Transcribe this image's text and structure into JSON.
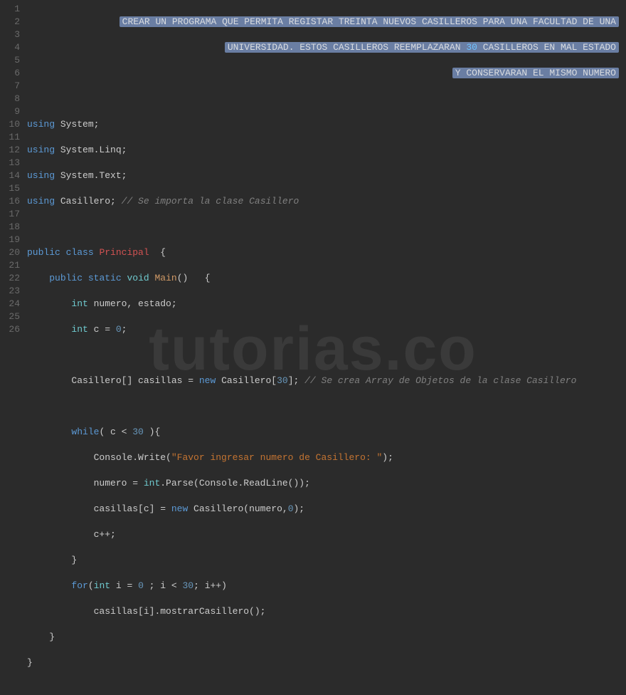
{
  "comment_banner": {
    "line1": "CREAR UN PROGRAMA QUE PERMITA REGISTAR TREINTA NUEVOS CASILLEROS PARA UNA FACULTAD DE UNA",
    "line2_pre": "UNIVERSIDAD. ESTOS CASILLEROS REEMPLAZARAN ",
    "line2_num": "30",
    "line2_post": " CASILLEROS EN MAL ESTADO",
    "line3": "Y CONSERVARAN EL MISMO NUMERO"
  },
  "code": {
    "using": "using",
    "ns_system": "System;",
    "ns_linq": "System.Linq;",
    "ns_text": "System.Text;",
    "ns_casillero": "Casillero;",
    "import_comment": "// Se importa la clase Casillero",
    "public": "public",
    "class": "class",
    "className": "Principal",
    "static": "static",
    "void": "void",
    "main": "Main",
    "parens_open_brace": "()   {",
    "int": "int",
    "decl_vars": " numero, estado;",
    "decl_c": " c = ",
    "zero": "0",
    "semi": ";",
    "casillero_type": "Casillero",
    "arr_decl": "[] casillas = ",
    "new": "new",
    "arr_alloc_pre": " Casillero[",
    "thirty": "30",
    "arr_alloc_post": "];",
    "arr_comment": "// Se crea Array de Objetos de la clase Casillero",
    "while": "while",
    "while_cond_pre": "( c < ",
    "while_cond_post": " ){",
    "console_write": "Console.Write(",
    "string_prompt": "\"Favor ingresar numero de Casillero: \"",
    "close_paren_semi": ");",
    "numero_assign": "numero = ",
    "int_parse": ".Parse(Console.ReadLine());",
    "casillas_assign_pre": "casillas[c] = ",
    "casillero_ctor_pre": " Casillero(numero,",
    "casillero_ctor_post": ");",
    "cpp": "c++;",
    "close_brace": "}",
    "for": "for",
    "for_open": "(",
    "for_i_decl": " i = ",
    "for_cond": " ; i < ",
    "for_post": "; i++)",
    "mostrar": "casillas[i].mostrarCasillero();",
    "open_brace_std": "  {"
  },
  "gutter": [
    "1",
    "2",
    "3",
    "4",
    "5",
    "6",
    "7",
    "8",
    "9",
    "10",
    "11",
    "12",
    "13",
    "14",
    "15",
    "16",
    "17",
    "18",
    "19",
    "20",
    "21",
    "22",
    "23",
    "24",
    "25",
    "26"
  ],
  "watermark": "tutorias.co"
}
